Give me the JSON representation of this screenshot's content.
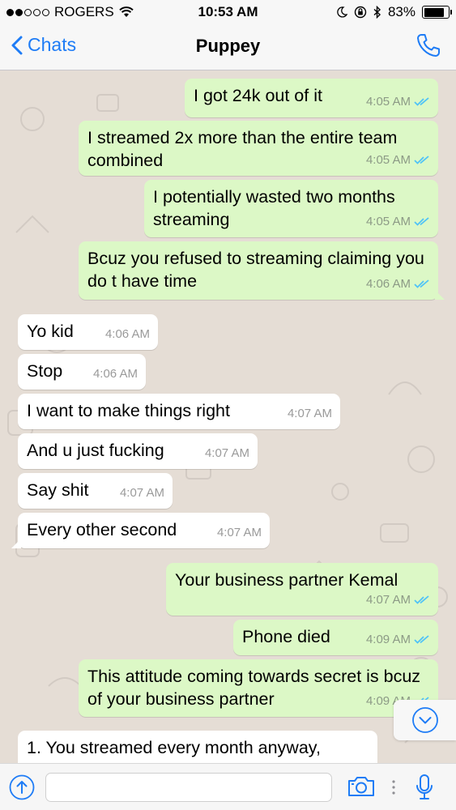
{
  "status_bar": {
    "carrier": "ROGERS",
    "time": "10:53 AM",
    "battery": "83%",
    "battery_level": 0.83
  },
  "nav": {
    "back_label": "Chats",
    "title": "Puppey"
  },
  "messages": [
    {
      "dir": "out",
      "text": "I got 24k out of it",
      "time": "4:05 AM",
      "read": true
    },
    {
      "dir": "out",
      "text": "I streamed 2x more than the entire team combined",
      "time": "4:05 AM",
      "read": true
    },
    {
      "dir": "out",
      "text": "I potentially wasted two months streaming",
      "time": "4:05 AM",
      "read": true
    },
    {
      "dir": "out",
      "text": "Bcuz you refused to streaming claiming you do t have time",
      "time": "4:06 AM",
      "read": true
    },
    {
      "dir": "in",
      "text": "Yo kid",
      "time": "4:06 AM"
    },
    {
      "dir": "in",
      "text": "Stop",
      "time": "4:06 AM"
    },
    {
      "dir": "in",
      "text": "I want to make things right",
      "time": "4:07 AM"
    },
    {
      "dir": "in",
      "text": "And u just fucking",
      "time": "4:07 AM"
    },
    {
      "dir": "in",
      "text": "Say shit",
      "time": "4:07 AM"
    },
    {
      "dir": "in",
      "text": "Every other second",
      "time": "4:07 AM"
    },
    {
      "dir": "out",
      "text": "Your business partner Kemal",
      "time": "4:07 AM",
      "read": true
    },
    {
      "dir": "out",
      "text": "Phone died",
      "time": "4:09 AM",
      "read": true
    },
    {
      "dir": "out",
      "text": "This attitude coming towards secret is bcuz of your business partner",
      "time": "4:09 AM",
      "read": true
    },
    {
      "dir": "in",
      "text": "1. You streamed every month anyway,",
      "time": ""
    }
  ],
  "colors": {
    "accent": "#1e7cf6",
    "outgoing_bubble": "#dcf8c6",
    "incoming_bubble": "#ffffff",
    "chat_background": "#e5ddd5",
    "read_ticks": "#4fc3f7"
  },
  "icons": {
    "back": "chevron-left-icon",
    "call": "phone-icon",
    "wifi": "wifi-icon",
    "scroll": "scroll-down-icon",
    "upload": "upload-arrow-icon",
    "camera": "camera-icon",
    "mic": "microphone-icon"
  }
}
